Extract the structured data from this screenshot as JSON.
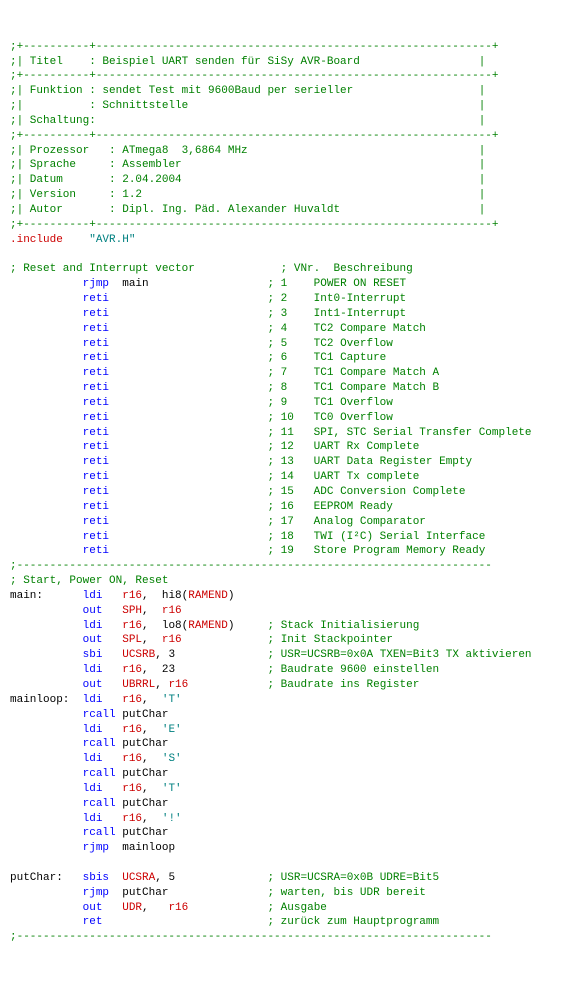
{
  "hdr": {
    "l1": ";+----------+------------------------------------------------------------+",
    "titel_l": ";| Titel    ",
    "titel_v": ": Beispiel UART senden für SiSy AVR-Board                  ",
    "sep1": ";+----------+------------------------------------------------------------+",
    "funk_l": ";| Funktion ",
    "funk_v": ": sendet Test mit 9600Baud per serieller                   ",
    "funk2_l": ";|          ",
    "funk2_v": ": Schnittstelle                                            ",
    "schalt_l": ";| Schaltung",
    "schalt_v": ":                                                          ",
    "sep2": ";+----------+------------------------------------------------------------+",
    "proz_l": ";| Prozessor   ",
    "proz_v": ": ATmega8  3,6864 MHz                                   ",
    "spra_l": ";| Sprache     ",
    "spra_v": ": Assembler                                             ",
    "datum_l": ";| Datum       ",
    "datum_v": ": 2.04.2004                                             ",
    "ver_l": ";| Version     ",
    "ver_v": ": 1.2                                                   ",
    "autor_l": ";| Autor       ",
    "autor_v": ": Dipl. Ing. Päd. Alexander Huvaldt                     ",
    "sep3": ";+----------+------------------------------------------------------------+"
  },
  "inc": {
    "dir": ".include",
    "file": "\"AVR.H\""
  },
  "vec": {
    "hdr_l": "; Reset and Interrupt vector             ",
    "hdr_r": "; VNr.  Beschreibung",
    "rows": [
      {
        "op": "rjmp",
        "arg": "main",
        "n": "1",
        "d": "POWER ON RESET"
      },
      {
        "op": "reti",
        "arg": "",
        "n": "2",
        "d": "Int0-Interrupt"
      },
      {
        "op": "reti",
        "arg": "",
        "n": "3",
        "d": "Int1-Interrupt"
      },
      {
        "op": "reti",
        "arg": "",
        "n": "4",
        "d": "TC2 Compare Match"
      },
      {
        "op": "reti",
        "arg": "",
        "n": "5",
        "d": "TC2 Overflow"
      },
      {
        "op": "reti",
        "arg": "",
        "n": "6",
        "d": "TC1 Capture"
      },
      {
        "op": "reti",
        "arg": "",
        "n": "7",
        "d": "TC1 Compare Match A"
      },
      {
        "op": "reti",
        "arg": "",
        "n": "8",
        "d": "TC1 Compare Match B"
      },
      {
        "op": "reti",
        "arg": "",
        "n": "9",
        "d": "TC1 Overflow"
      },
      {
        "op": "reti",
        "arg": "",
        "n": "10",
        "d": "TC0 Overflow"
      },
      {
        "op": "reti",
        "arg": "",
        "n": "11",
        "d": "SPI, STC Serial Transfer Complete"
      },
      {
        "op": "reti",
        "arg": "",
        "n": "12",
        "d": "UART Rx Complete"
      },
      {
        "op": "reti",
        "arg": "",
        "n": "13",
        "d": "UART Data Register Empty"
      },
      {
        "op": "reti",
        "arg": "",
        "n": "14",
        "d": "UART Tx complete"
      },
      {
        "op": "reti",
        "arg": "",
        "n": "15",
        "d": "ADC Conversion Complete"
      },
      {
        "op": "reti",
        "arg": "",
        "n": "16",
        "d": "EEPROM Ready"
      },
      {
        "op": "reti",
        "arg": "",
        "n": "17",
        "d": "Analog Comparator"
      },
      {
        "op": "reti",
        "arg": "",
        "n": "18",
        "d": "TWI (I²C) Serial Interface"
      },
      {
        "op": "reti",
        "arg": "",
        "n": "19",
        "d": "Store Program Memory Ready"
      }
    ]
  },
  "dash": ";------------------------------------------------------------------------",
  "start_hdr": "; Start, Power ON, Reset",
  "main": [
    {
      "lbl": "main:",
      "op": "ldi",
      "a1": "r16",
      "sep": ",  ",
      "a2p": "hi8(",
      "a2": "RAMEND",
      "a2s": ")",
      "c": ""
    },
    {
      "lbl": "",
      "op": "out",
      "a1": "SPH",
      "sep": ",  ",
      "a2": "r16",
      "c": ""
    },
    {
      "lbl": "",
      "op": "ldi",
      "a1": "r16",
      "sep": ",  ",
      "a2p": "lo8(",
      "a2": "RAMEND",
      "a2s": ")",
      "c": "; Stack Initialisierung"
    },
    {
      "lbl": "",
      "op": "out",
      "a1": "SPL",
      "sep": ",  ",
      "a2": "r16",
      "c": "; Init Stackpointer"
    },
    {
      "lbl": "",
      "op": "sbi",
      "a1": "UCSRB",
      "sep": ", ",
      "a2k": "3",
      "c": "; USR=UCSRB=0x0A TXEN=Bit3 TX aktivieren"
    },
    {
      "lbl": "",
      "op": "ldi",
      "a1": "r16",
      "sep": ",  ",
      "a2k": "23",
      "c": "; Baudrate 9600 einstellen"
    },
    {
      "lbl": "",
      "op": "out",
      "a1": "UBRRL",
      "sep": ", ",
      "a2": "r16",
      "c": "; Baudrate ins Register"
    },
    {
      "lbl": "mainloop:",
      "op": "ldi",
      "a1": "r16",
      "sep": ",  ",
      "str": "'T'",
      "c": ""
    },
    {
      "lbl": "",
      "op": "rcall",
      "plain": "putChar"
    },
    {
      "lbl": "",
      "op": "ldi",
      "a1": "r16",
      "sep": ",  ",
      "str": "'E'",
      "c": ""
    },
    {
      "lbl": "",
      "op": "rcall",
      "plain": "putChar"
    },
    {
      "lbl": "",
      "op": "ldi",
      "a1": "r16",
      "sep": ",  ",
      "str": "'S'",
      "c": ""
    },
    {
      "lbl": "",
      "op": "rcall",
      "plain": "putChar"
    },
    {
      "lbl": "",
      "op": "ldi",
      "a1": "r16",
      "sep": ",  ",
      "str": "'T'",
      "c": ""
    },
    {
      "lbl": "",
      "op": "rcall",
      "plain": "putChar"
    },
    {
      "lbl": "",
      "op": "ldi",
      "a1": "r16",
      "sep": ",  ",
      "str": "'!'",
      "c": ""
    },
    {
      "lbl": "",
      "op": "rcall",
      "plain": "putChar"
    },
    {
      "lbl": "",
      "op": "rjmp",
      "plain": "mainloop"
    }
  ],
  "put": [
    {
      "lbl": "putChar:",
      "op": "sbis",
      "a1": "UCSRA",
      "sep": ", ",
      "a2k": "5",
      "c": "; USR=UCSRA=0x0B UDRE=Bit5"
    },
    {
      "lbl": "",
      "op": "rjmp",
      "plain": "putChar",
      "c": "; warten, bis UDR bereit"
    },
    {
      "lbl": "",
      "op": "out",
      "a1": "UDR",
      "sep": ",   ",
      "a2": "r16",
      "c": "; Ausgabe"
    },
    {
      "lbl": "",
      "op": "ret",
      "c": "; zurück zum Hauptprogramm"
    }
  ]
}
